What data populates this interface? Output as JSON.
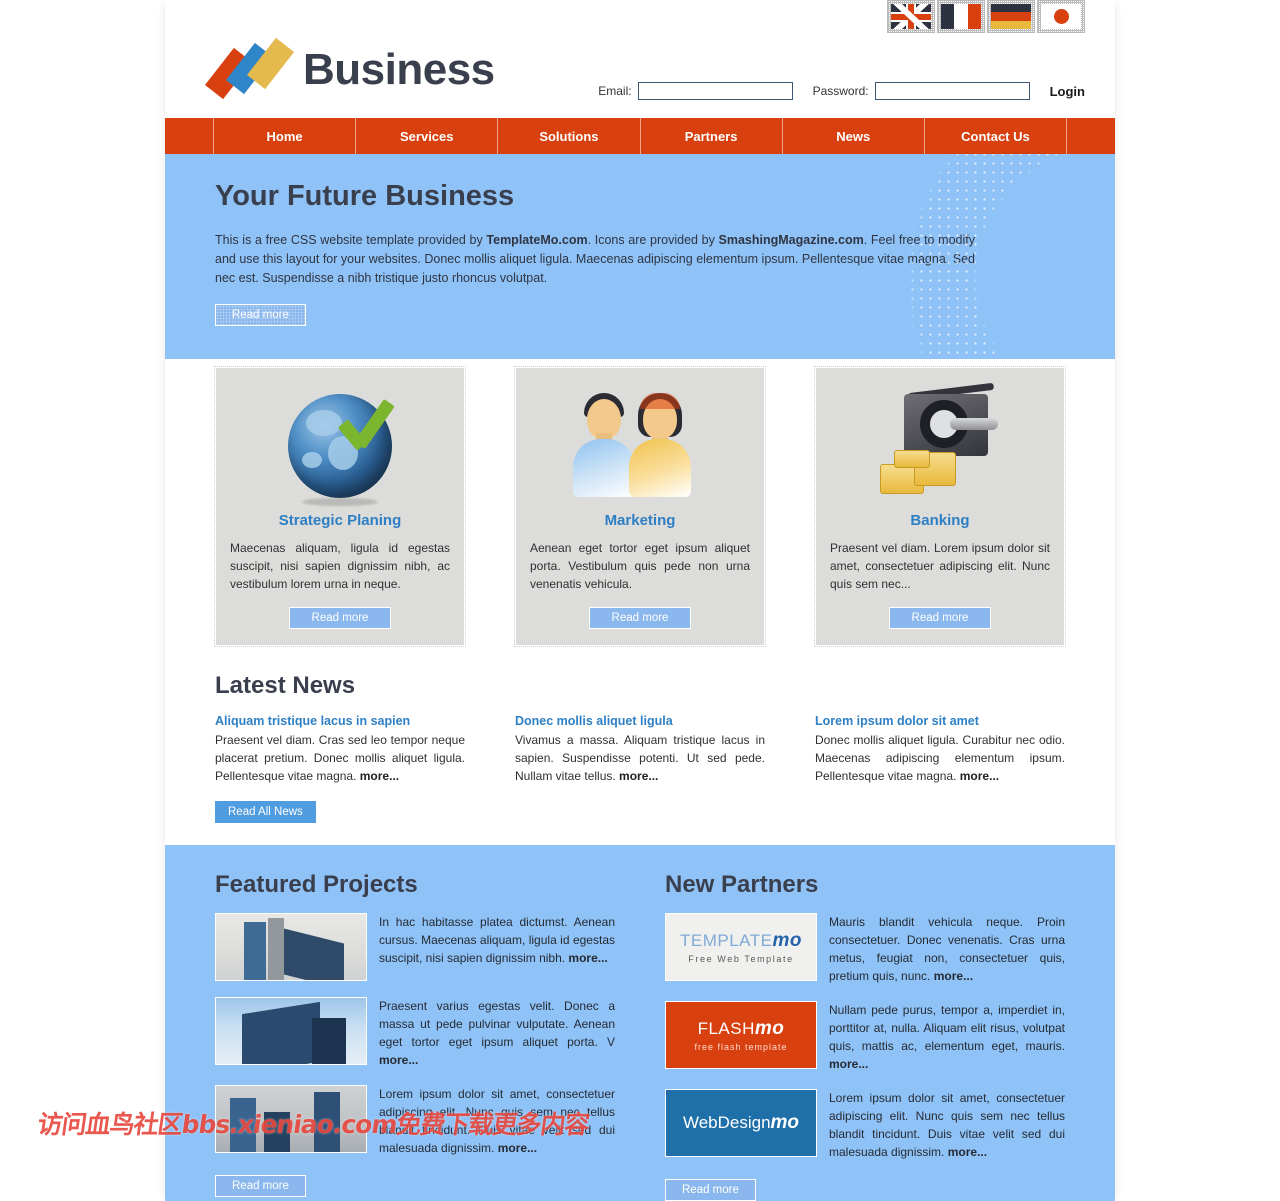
{
  "header": {
    "brand": "Business",
    "flags": [
      "uk-flag",
      "france-flag",
      "germany-flag",
      "japan-flag"
    ],
    "login": {
      "email_label": "Email:",
      "email_value": "",
      "password_label": "Password:",
      "password_value": "",
      "login_label": "Login"
    }
  },
  "nav": {
    "items": [
      {
        "label": "Home"
      },
      {
        "label": "Services"
      },
      {
        "label": "Solutions"
      },
      {
        "label": "Partners"
      },
      {
        "label": "News"
      },
      {
        "label": "Contact Us"
      }
    ]
  },
  "hero": {
    "title": "Your Future Business",
    "text_1": "This is a free CSS website template provided by ",
    "link_1": "TemplateMo.com",
    "text_2": ". Icons are provided by ",
    "link_2": "SmashingMagazine.com",
    "text_3": ". Feel free to modify and use this layout for your websites. Donec mollis aliquet ligula. Maecenas adipiscing elementum ipsum. Pellentesque vitae magna. Sed nec est. Suspendisse a nibh tristique justo rhoncus volutpat.",
    "button": "Read more"
  },
  "features": [
    {
      "icon": "globe-check-icon",
      "title": "Strategic Planing",
      "text": "Maecenas aliquam, ligula id egestas suscipit, nisi sapien dignissim nibh, ac vestibulum lorem urna in neque.",
      "button": "Read more"
    },
    {
      "icon": "people-icon",
      "title": "Marketing",
      "text": "Aenean eget tortor eget ipsum aliquet porta. Vestibulum quis pede non urna venenatis vehicula.",
      "button": "Read more"
    },
    {
      "icon": "money-press-icon",
      "title": "Banking",
      "text": "Praesent vel diam. Lorem ipsum dolor sit amet, consectetuer adipiscing elit. Nunc quis sem nec...",
      "button": "Read more"
    }
  ],
  "latest_news": {
    "heading": "Latest News",
    "items": [
      {
        "title": "Aliquam tristique lacus in sapien",
        "text": "Praesent vel diam. Cras sed leo tempor neque placerat pretium. Donec mollis aliquet ligula. Pellentesque vitae magna. ",
        "more": "more..."
      },
      {
        "title": "Donec mollis aliquet ligula",
        "text": "Vivamus a massa. Aliquam tristique lacus in sapien. Suspendisse potenti. Ut sed pede. Nullam vitae tellus. ",
        "more": "more..."
      },
      {
        "title": "Lorem ipsum dolor sit amet",
        "text": "Donec mollis aliquet ligula. Curabitur nec odio. Maecenas adipiscing elementum ipsum. Pellentesque vitae magna. ",
        "more": "more..."
      }
    ],
    "button": "Read All News"
  },
  "featured_projects": {
    "heading": "Featured Projects",
    "items": [
      {
        "thumb": "construction-site-photo",
        "text": "In hac habitasse platea dictumst. Aenean cursus. Maecenas aliquam, ligula id egestas suscipit, nisi sapien dignissim nibh. ",
        "more": "more..."
      },
      {
        "thumb": "office-tower-photo",
        "text": "Praesent varius egestas velit. Donec a massa ut pede pulvinar vulputate. Aenean eget tortor eget ipsum aliquet porta. V ",
        "more": "more..."
      },
      {
        "thumb": "city-skyline-photo",
        "text": "Lorem ipsum dolor sit amet, consectetuer adipiscing elit. Nunc quis sem nec tellus blandit tincidunt. Duis vitae velit sed dui malesuada dignissim. ",
        "more": "more..."
      }
    ],
    "button": "Read more"
  },
  "new_partners": {
    "heading": "New Partners",
    "items": [
      {
        "logo_name": "templatemo-logo",
        "logo_line1": "TEMPLATE",
        "logo_line1_em": "mo",
        "logo_line2": "Free Web Template",
        "text": "Mauris blandit vehicula neque. Proin consectetuer. Donec venenatis. Cras urna metus, feugiat non, consectetuer quis, pretium quis, nunc. ",
        "more": "more..."
      },
      {
        "logo_name": "flashmo-logo",
        "logo_line1": "FLASH",
        "logo_line1_em": "mo",
        "logo_line2": "free flash template",
        "text": "Nullam pede purus, tempor a, imperdiet in, porttitor at, nulla. Aliquam elit risus, volutpat quis, mattis ac, elementum eget, mauris. ",
        "more": "more..."
      },
      {
        "logo_name": "webdesignmo-logo",
        "logo_line1": "WebDesign",
        "logo_line1_em": "mo",
        "logo_line2": "",
        "text": "Lorem ipsum dolor sit amet, consectetuer adipiscing elit. Nunc quis sem nec tellus blandit tincidunt. Duis vitae velit sed dui malesuada dignissim. ",
        "more": "more..."
      }
    ],
    "button": "Read more"
  },
  "watermark": {
    "text": "访问血鸟社区bbs.xieniao.com免费下载更多内容"
  },
  "colors": {
    "accent_orange": "#d9400f",
    "hero_blue": "#8fc2f7",
    "link_blue": "#2e7fc4",
    "box_gray": "#dcdcda",
    "text_dark": "#3a3f4d"
  }
}
